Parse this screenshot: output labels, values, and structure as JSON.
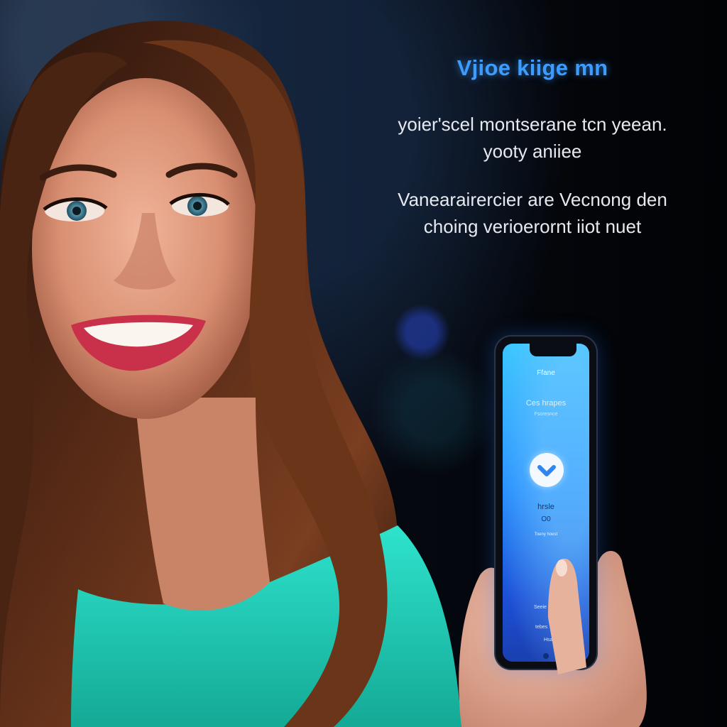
{
  "headline": {
    "title": "Vjioe kiige mn",
    "subtitle_lines": [
      "yoier'scel montserane tcn yeean.",
      "yooty aniiee"
    ],
    "body_lines": [
      "Vanearairercier are Vecnong den",
      "choing verioerornt iiot nuet"
    ]
  },
  "phone_screen": {
    "top_label": "Ffane",
    "heading": "Ces hrapes",
    "subheading": "Fsoresnce",
    "center_label": "hrsle",
    "center_value": "O0",
    "small_caption": "Toeny hoest",
    "lower_line_1": "Seeie",
    "lower_line_2": "tebes",
    "lower_line_3": "Hsa",
    "button_icon": "check-chevron-icon"
  },
  "colors": {
    "title_blue": "#3c9cff",
    "screen_top": "#35c7ff",
    "screen_bottom": "#1a3fb0",
    "shirt_teal": "#1fd6c0"
  }
}
